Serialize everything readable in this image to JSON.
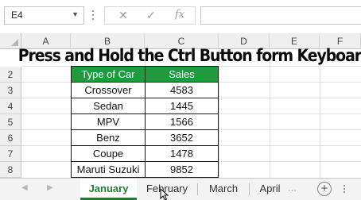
{
  "formula_bar": {
    "name_box": "E4",
    "dropdown_icon": "chevron-down-icon",
    "cancel_icon": "close-icon",
    "enter_icon": "checkmark-icon",
    "function_icon": "fx-icon",
    "cancel_glyph": "✕",
    "enter_glyph": "✓",
    "function_glyph": "fx",
    "formula": ""
  },
  "headline": "Press and Hold the Ctrl Button form Keyboard",
  "columns": [
    "A",
    "B",
    "C",
    "D",
    "E",
    "F"
  ],
  "rows": [
    "2",
    "3",
    "4",
    "5",
    "6",
    "7",
    "8"
  ],
  "table": {
    "headers": [
      "Type of Car",
      "Sales"
    ],
    "rows": [
      [
        "Crossover",
        "4583"
      ],
      [
        "Sedan",
        "1445"
      ],
      [
        "MPV",
        "1566"
      ],
      [
        "Benz",
        "3652"
      ],
      [
        "Coupe",
        "1478"
      ],
      [
        "Maruti Suzuki",
        "9852"
      ]
    ],
    "header_color": "#1f9a3d"
  },
  "sheet_tabs": {
    "tabs": [
      "January",
      "February",
      "March",
      "April"
    ],
    "active": "January",
    "more": "...",
    "add": "+"
  },
  "accent_color": "#1e7e34"
}
